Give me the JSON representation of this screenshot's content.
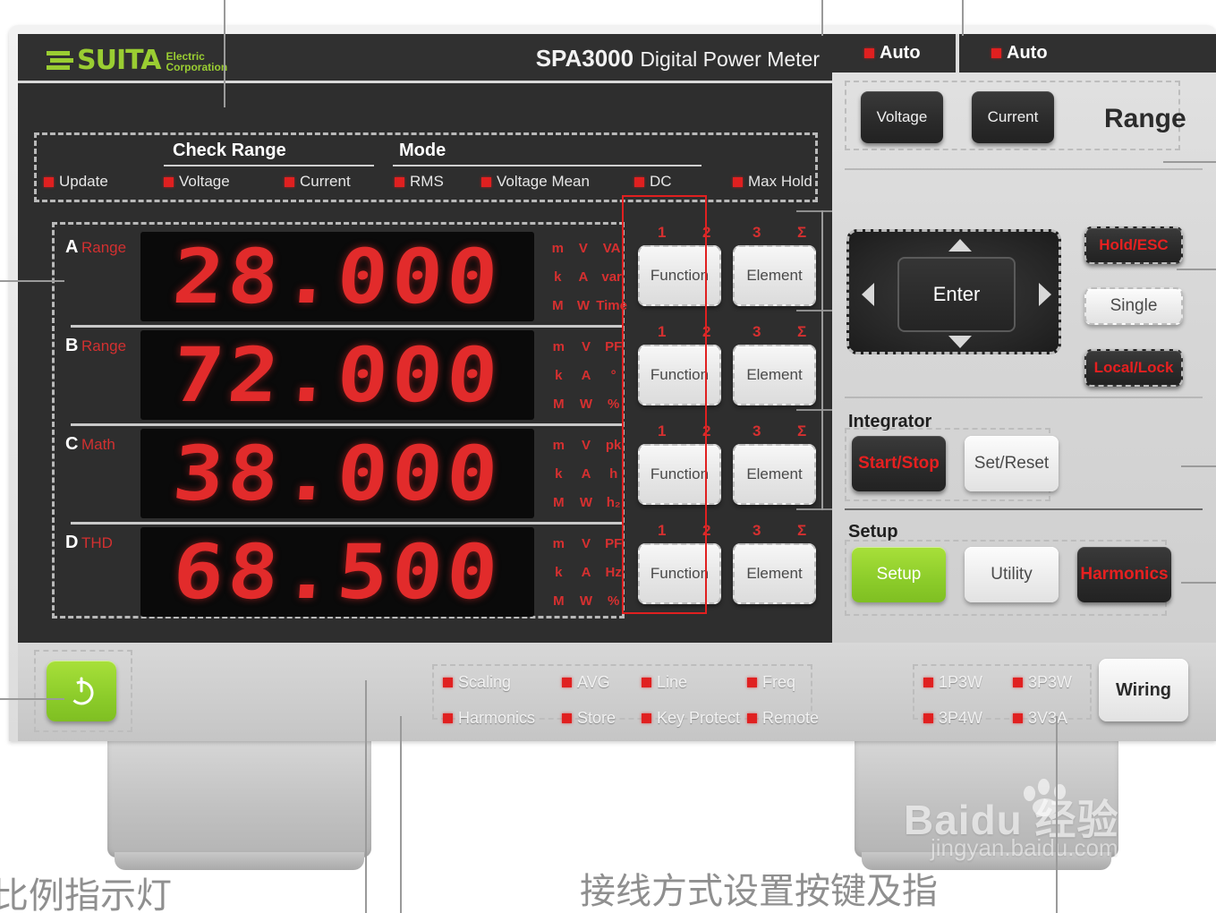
{
  "device": {
    "brand": "SUITA",
    "brand_sub_line1": "Electric",
    "brand_sub_line2": "Corporation",
    "model": "SPA3000",
    "model_subtitle": "Digital Power Meter",
    "accent_green": "#9acd32",
    "led_red": "#e02020",
    "segment_red": "#e22b2b"
  },
  "status_strip": {
    "update_label": "Update",
    "check_range_title": "Check Range",
    "check_range_items": [
      "Voltage",
      "Current"
    ],
    "mode_title": "Mode",
    "mode_items": [
      "RMS",
      "Voltage Mean",
      "DC",
      "Max Hold"
    ]
  },
  "readouts": [
    {
      "channel": "A",
      "channel_label": "Range",
      "value": "28.000",
      "units": [
        "m",
        "V",
        "VA",
        "k",
        "A",
        "var",
        "M",
        "W",
        "Time"
      ]
    },
    {
      "channel": "B",
      "channel_label": "Range",
      "value": "72.000",
      "units": [
        "m",
        "V",
        "PF",
        "k",
        "A",
        "°",
        "M",
        "W",
        "%"
      ]
    },
    {
      "channel": "C",
      "channel_label": "Math",
      "value": "38.000",
      "units": [
        "m",
        "V",
        "pk",
        "k",
        "A",
        "h",
        "M",
        "W",
        "h₂"
      ]
    },
    {
      "channel": "D",
      "channel_label": "THD",
      "value": "68.500",
      "units": [
        "m",
        "V",
        "PF",
        "k",
        "A",
        "Hz",
        "M",
        "W",
        "%"
      ]
    }
  ],
  "key_grid": {
    "indicators": [
      "1",
      "2",
      "3",
      "Σ"
    ],
    "function_label": "Function",
    "element_label": "Element",
    "rows": 4,
    "highlight_color": "#e02020"
  },
  "range_section": {
    "auto_left_label": "Auto",
    "auto_right_label": "Auto",
    "voltage_button": "Voltage",
    "current_button": "Current",
    "section_label": "Range"
  },
  "nav_pad": {
    "enter_label": "Enter",
    "up_icon": "arrow-up-icon",
    "down_icon": "arrow-down-icon",
    "left_icon": "arrow-left-icon",
    "right_icon": "arrow-right-icon"
  },
  "side_buttons": {
    "hold_esc": "Hold/ESC",
    "single": "Single",
    "local_lock": "Local/Lock"
  },
  "integrator": {
    "title": "Integrator",
    "start_stop": "Start/Stop",
    "set_reset": "Set/Reset"
  },
  "setup": {
    "title": "Setup",
    "setup_button": "Setup",
    "utility_button": "Utility",
    "harmonics_button": "Harmonics"
  },
  "bottom": {
    "power_icon": "power-icon",
    "indicators_row1": [
      "Scaling",
      "AVG",
      "Line",
      "Freq"
    ],
    "indicators_row2": [
      "Harmonics",
      "Store",
      "Key Protect",
      "Remote"
    ],
    "wiring_indicators_row1": [
      "1P3W",
      "3P3W"
    ],
    "wiring_indicators_row2": [
      "3P4W",
      "3V3A"
    ],
    "wiring_button": "Wiring"
  },
  "annotations": {
    "bottom_left": "比例指示灯",
    "bottom_center": "接线方式设置按键及指"
  },
  "watermark": {
    "main": "Baidu 经验",
    "sub": "jingyan.baidu.com"
  }
}
